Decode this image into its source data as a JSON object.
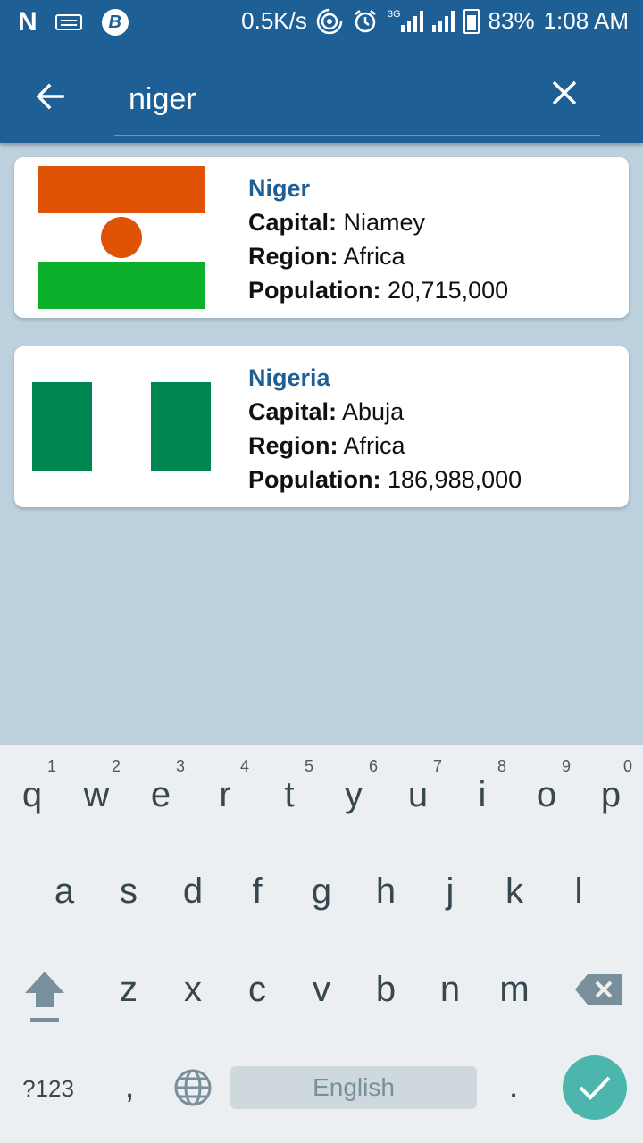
{
  "status_bar": {
    "network_speed": "0.5K/s",
    "network_type": "3G",
    "battery": "83%",
    "time": "1:08 AM",
    "icons": [
      "n-icon",
      "keyboard-icon",
      "b-icon",
      "hotspot-icon",
      "alarm-icon",
      "signal-icon",
      "signal-icon",
      "battery-charging-icon"
    ]
  },
  "toolbar": {
    "back_icon": "arrow-back-icon",
    "search_value": "niger",
    "clear_icon": "close-icon"
  },
  "results": [
    {
      "name": "Niger",
      "capital_label": "Capital:",
      "capital": "Niamey",
      "region_label": "Region:",
      "region": "Africa",
      "population_label": "Population:",
      "population": "20,715,000",
      "flag_colors": {
        "top": "#e05206",
        "middle": "#ffffff",
        "bottom": "#0db02b",
        "disc": "#e05206"
      }
    },
    {
      "name": "Nigeria",
      "capital_label": "Capital:",
      "capital": "Abuja",
      "region_label": "Region:",
      "region": "Africa",
      "population_label": "Population:",
      "population": "186,988,000",
      "flag_colors": {
        "left": "#008751",
        "middle": "#ffffff",
        "right": "#008751"
      }
    }
  ],
  "keyboard": {
    "row1": [
      "q",
      "w",
      "e",
      "r",
      "t",
      "y",
      "u",
      "i",
      "o",
      "p"
    ],
    "row1_hints": [
      "1",
      "2",
      "3",
      "4",
      "5",
      "6",
      "7",
      "8",
      "9",
      "0"
    ],
    "row2": [
      "a",
      "s",
      "d",
      "f",
      "g",
      "h",
      "j",
      "k",
      "l"
    ],
    "row3": [
      "z",
      "x",
      "c",
      "v",
      "b",
      "n",
      "m"
    ],
    "symbols_key": "?123",
    "comma_key": ",",
    "space_label": "English",
    "period_key": ".",
    "accent_color": "#4db6ac"
  }
}
